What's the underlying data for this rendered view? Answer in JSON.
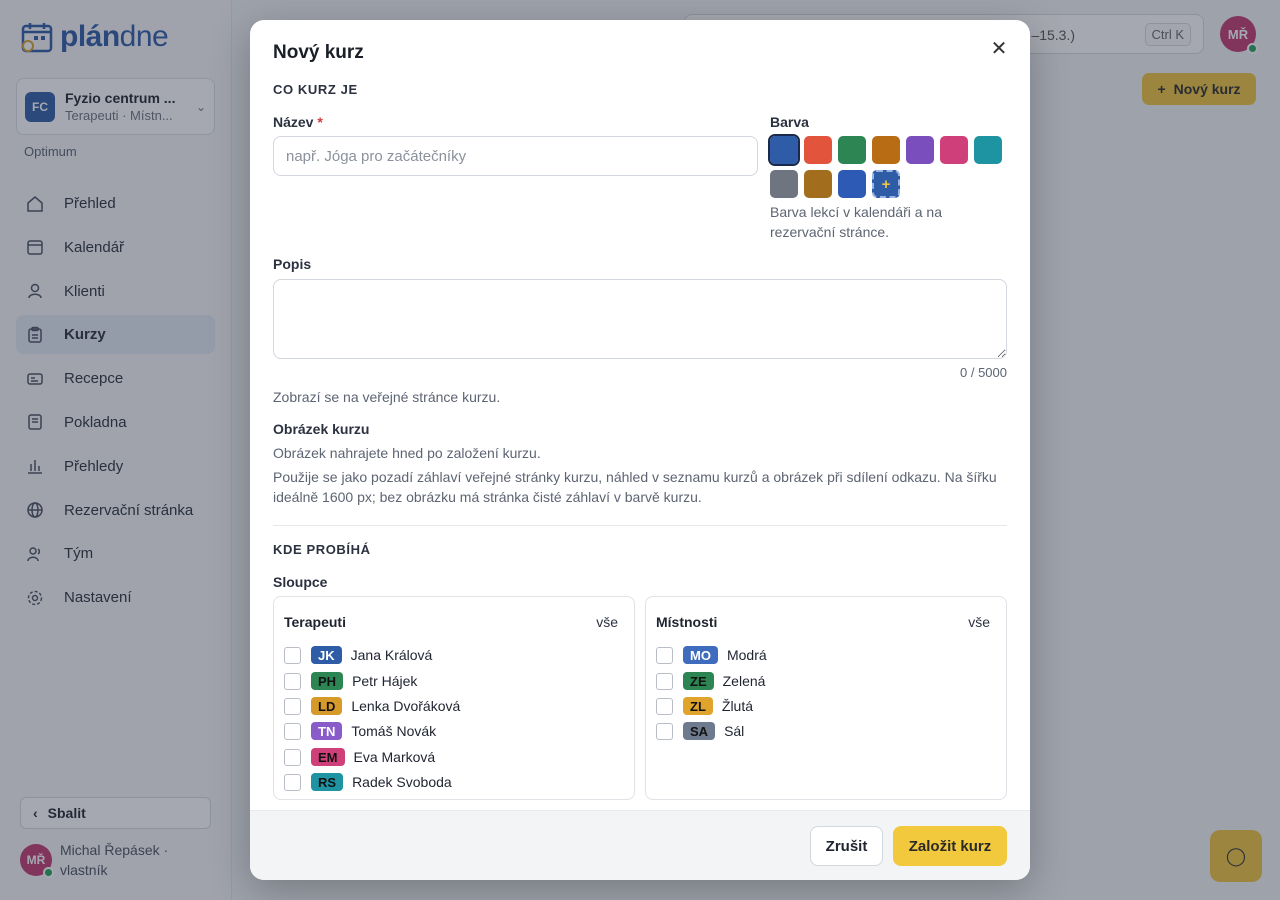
{
  "brand": {
    "logo_bold": "plán",
    "logo_light": "dne"
  },
  "org": {
    "initials": "FC",
    "name": "Fyzio centrum ...",
    "subtitle": "Terapeuti · Místn...",
    "plan": "Optimum"
  },
  "sidebar": {
    "items": [
      {
        "label": "Přehled",
        "icon": "home-icon"
      },
      {
        "label": "Kalendář",
        "icon": "calendar-icon"
      },
      {
        "label": "Klienti",
        "icon": "user-icon"
      },
      {
        "label": "Kurzy",
        "icon": "clipboard-icon",
        "active": true
      },
      {
        "label": "Recepce",
        "icon": "id-card-icon"
      },
      {
        "label": "Pokladna",
        "icon": "receipt-icon"
      },
      {
        "label": "Přehledy",
        "icon": "bar-chart-icon"
      },
      {
        "label": "Rezervační stránka",
        "icon": "globe-icon"
      },
      {
        "label": "Tým",
        "icon": "team-icon"
      },
      {
        "label": "Nastavení",
        "icon": "gear-icon"
      }
    ],
    "collapse_label": "Sbalit"
  },
  "user": {
    "initials": "MŘ",
    "name": "Michal Řepásek · vlastník",
    "status_color": "#22a35a"
  },
  "header": {
    "search_hint": "–15.3.)",
    "shortcut": "Ctrl K",
    "avatar": "MŘ",
    "new_course_label": "Nový kurz"
  },
  "modal": {
    "title": "Nový kurz",
    "section_what": "CO KURZ JE",
    "name_label": "Název",
    "required_mark": "*",
    "name_placeholder": "např. Jóga pro začátečníky",
    "color_label": "Barva",
    "colors": [
      "#2f5ca6",
      "#e2543c",
      "#2e8554",
      "#b86d14",
      "#7a4fbd",
      "#cf3f79",
      "#1e94a3",
      "#6e7480",
      "#a26e1e",
      "#2d5ab4"
    ],
    "color_add": "+",
    "color_help": "Barva lekcí v kalendáři a na rezervační stránce.",
    "desc_label": "Popis",
    "desc_counter": "0 / 5000",
    "desc_help": "Zobrazí se na veřejné stránce kurzu.",
    "image_label": "Obrázek kurzu",
    "image_help1": "Obrázek nahrajete hned po založení kurzu.",
    "image_help2": "Použije se jako pozadí záhlaví veřejné stránky kurzu, náhled v seznamu kurzů a obrázek při sdílení odkazu. Na šířku ideálně 1600 px; bez obrázku má stránka čisté záhlaví v barvě kurzu.",
    "section_where": "KDE PROBÍHÁ",
    "columns_label": "Sloupce",
    "therapists_title": "Terapeuti",
    "rooms_title": "Místnosti",
    "all_label": "vše",
    "therapists": [
      {
        "tag": "JK",
        "name": "Jana Králová",
        "bg": "#2f5ca6",
        "fg": "#ffffff"
      },
      {
        "tag": "PH",
        "name": "Petr Hájek",
        "bg": "#2e8554",
        "fg": "#111111"
      },
      {
        "tag": "LD",
        "name": "Lenka Dvořáková",
        "bg": "#d69a2a",
        "fg": "#111111"
      },
      {
        "tag": "TN",
        "name": "Tomáš Novák",
        "bg": "#8a5cc9",
        "fg": "#ffffff"
      },
      {
        "tag": "EM",
        "name": "Eva Marková",
        "bg": "#cf3f79",
        "fg": "#111111"
      },
      {
        "tag": "RS",
        "name": "Radek Svoboda",
        "bg": "#1e94a3",
        "fg": "#111111"
      }
    ],
    "rooms": [
      {
        "tag": "MO",
        "name": "Modrá",
        "bg": "#3f6cbc",
        "fg": "#ffffff"
      },
      {
        "tag": "ZE",
        "name": "Zelená",
        "bg": "#2e8554",
        "fg": "#111111"
      },
      {
        "tag": "ZL",
        "name": "Žlutá",
        "bg": "#e0a32c",
        "fg": "#111111"
      },
      {
        "tag": "SA",
        "name": "Sál",
        "bg": "#6e7a8e",
        "fg": "#111111"
      }
    ],
    "cancel_label": "Zrušit",
    "create_label": "Založit kurz"
  }
}
